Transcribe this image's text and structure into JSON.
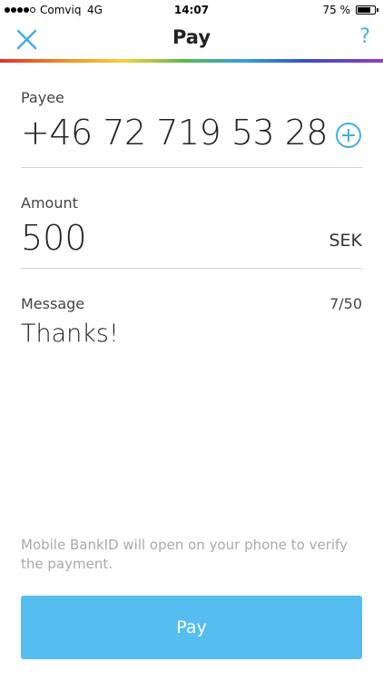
{
  "status_bar": {
    "signal_bars_filled": 4,
    "signal_bars_total": 5,
    "carrier": "Comviq",
    "network": "4G",
    "time": "14:07",
    "battery_percent_text": "75 %",
    "battery_level": 0.75
  },
  "nav": {
    "title": "Pay",
    "close_icon": "close-x-icon",
    "help_label": "?"
  },
  "colors": {
    "accent": "#3fb1e3",
    "pay_button": "#56bdf0",
    "divider": "#d4d4d4",
    "hint_text": "#a9a9a9"
  },
  "form": {
    "payee": {
      "label": "Payee",
      "value": "+46 72 719 53 28",
      "add_icon": "plus-circle-icon"
    },
    "amount": {
      "label": "Amount",
      "value": "500",
      "currency": "SEK"
    },
    "message": {
      "label": "Message",
      "counter": "7/50",
      "value": "Thanks!"
    }
  },
  "footer": {
    "info": "Mobile BankID will open on your phone to verify the payment.",
    "pay_button_label": "Pay"
  }
}
